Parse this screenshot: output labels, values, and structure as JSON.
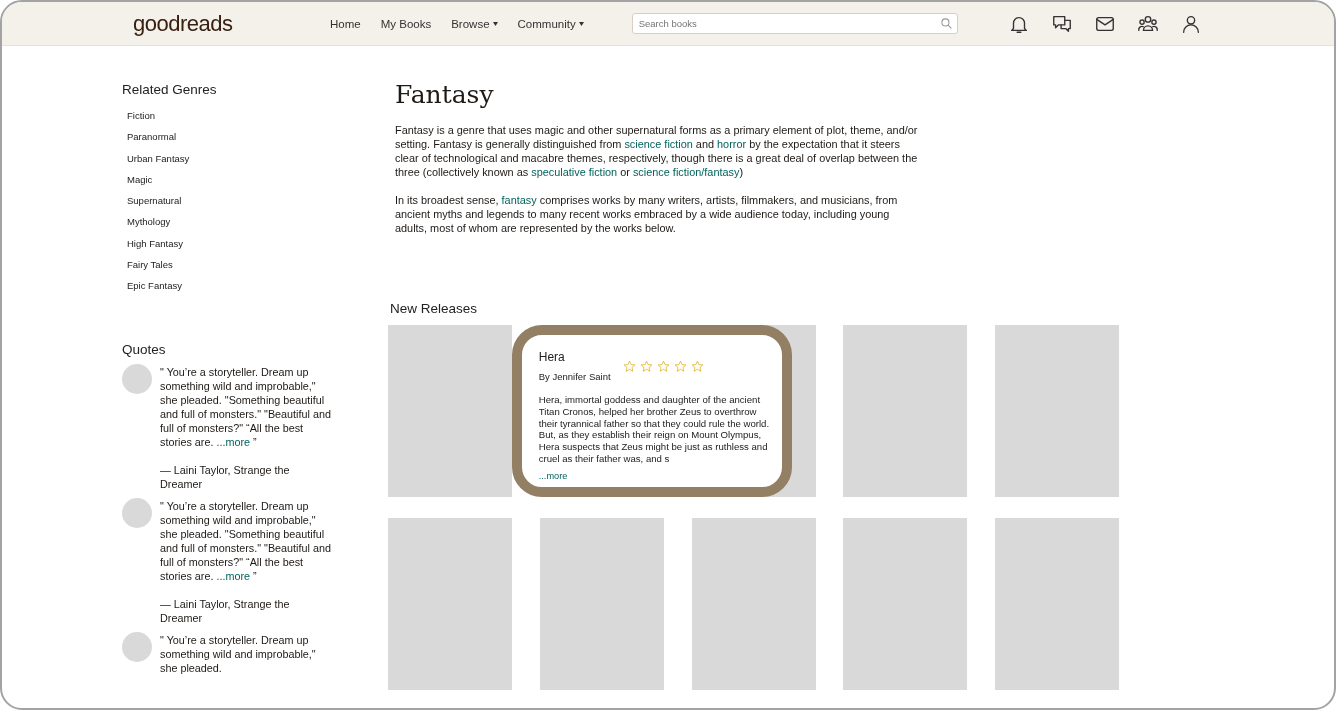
{
  "header": {
    "logo": "goodreads",
    "nav": [
      {
        "label": "Home",
        "dropdown": false
      },
      {
        "label": "My Books",
        "dropdown": false
      },
      {
        "label": "Browse",
        "dropdown": true
      },
      {
        "label": "Community",
        "dropdown": true
      }
    ],
    "search": {
      "placeholder": "Search books"
    }
  },
  "sidebar": {
    "genres_title": "Related Genres",
    "genres": [
      "Fiction",
      "Paranormal",
      "Urban Fantasy",
      "Magic",
      "Supernatural",
      "Mythology",
      "High Fantasy",
      "Fairy Tales",
      "Epic Fantasy"
    ],
    "quotes_title": "Quotes",
    "quotes": [
      {
        "text": "\" You’re a storyteller. Dream up something wild and improbable,\" she pleaded. \"Something beautiful and full of monsters.\" \"Beautiful and full of monsters?\" “All the best stories are.",
        "more": "...more",
        "close": "”",
        "attribution": "— Laini Taylor, Strange the Dreamer"
      },
      {
        "text": "\" You’re a storyteller. Dream up something wild and improbable,\" she pleaded. \"Something beautiful and full of monsters.\" \"Beautiful and full of monsters?\" “All the best stories are.",
        "more": "...more",
        "close": "”",
        "attribution": "— Laini Taylor, Strange the Dreamer"
      },
      {
        "text": "\" You’re a storyteller. Dream up something wild and improbable,\" she pleaded."
      }
    ]
  },
  "genre": {
    "title": "Fantasy",
    "paragraphs": [
      [
        {
          "kind": "text",
          "text": "Fantasy is a genre that uses magic and other supernatural forms as a primary element of plot, theme, and/or setting. Fantasy is generally distinguished from "
        },
        {
          "kind": "link",
          "text": "science fiction"
        },
        {
          "kind": "text",
          "text": " and "
        },
        {
          "kind": "link",
          "text": "horror"
        },
        {
          "kind": "text",
          "text": " by the expectation that it steers clear of technological and macabre themes, respectively, though there is a great deal of overlap between the three (collectively known as "
        },
        {
          "kind": "link",
          "text": "speculative fiction"
        },
        {
          "kind": "text",
          "text": " or "
        },
        {
          "kind": "link",
          "text": "science fiction/fantasy"
        },
        {
          "kind": "text",
          "text": ")"
        }
      ],
      [
        {
          "kind": "text",
          "text": "In its broadest sense, "
        },
        {
          "kind": "link",
          "text": "fantasy"
        },
        {
          "kind": "text",
          "text": " comprises works by many writers, artists, filmmakers, and musicians, from ancient myths and legends to many recent works embraced by a wide audience today, including young adults, most of whom are represented by the works below."
        }
      ]
    ]
  },
  "new_releases": {
    "title": "New Releases",
    "books": [
      {
        "hovered": false
      },
      {
        "hovered": true,
        "title": "Hera",
        "author": "By Jennifer Saint",
        "stars": 0,
        "blurb": "Hera, immortal goddess and daughter of the ancient Titan Cronos, helped her brother Zeus to overthrow their tyrannical father so that they could rule the world. But, as they establish their reign on Mount Olympus, Hera suspects that Zeus might be just as ruthless and cruel as their father was, and s",
        "more": "...more"
      },
      {
        "hovered": false
      },
      {
        "hovered": false
      },
      {
        "hovered": false
      },
      {
        "hovered": false
      },
      {
        "hovered": false
      },
      {
        "hovered": false
      },
      {
        "hovered": false
      },
      {
        "hovered": false
      }
    ]
  }
}
